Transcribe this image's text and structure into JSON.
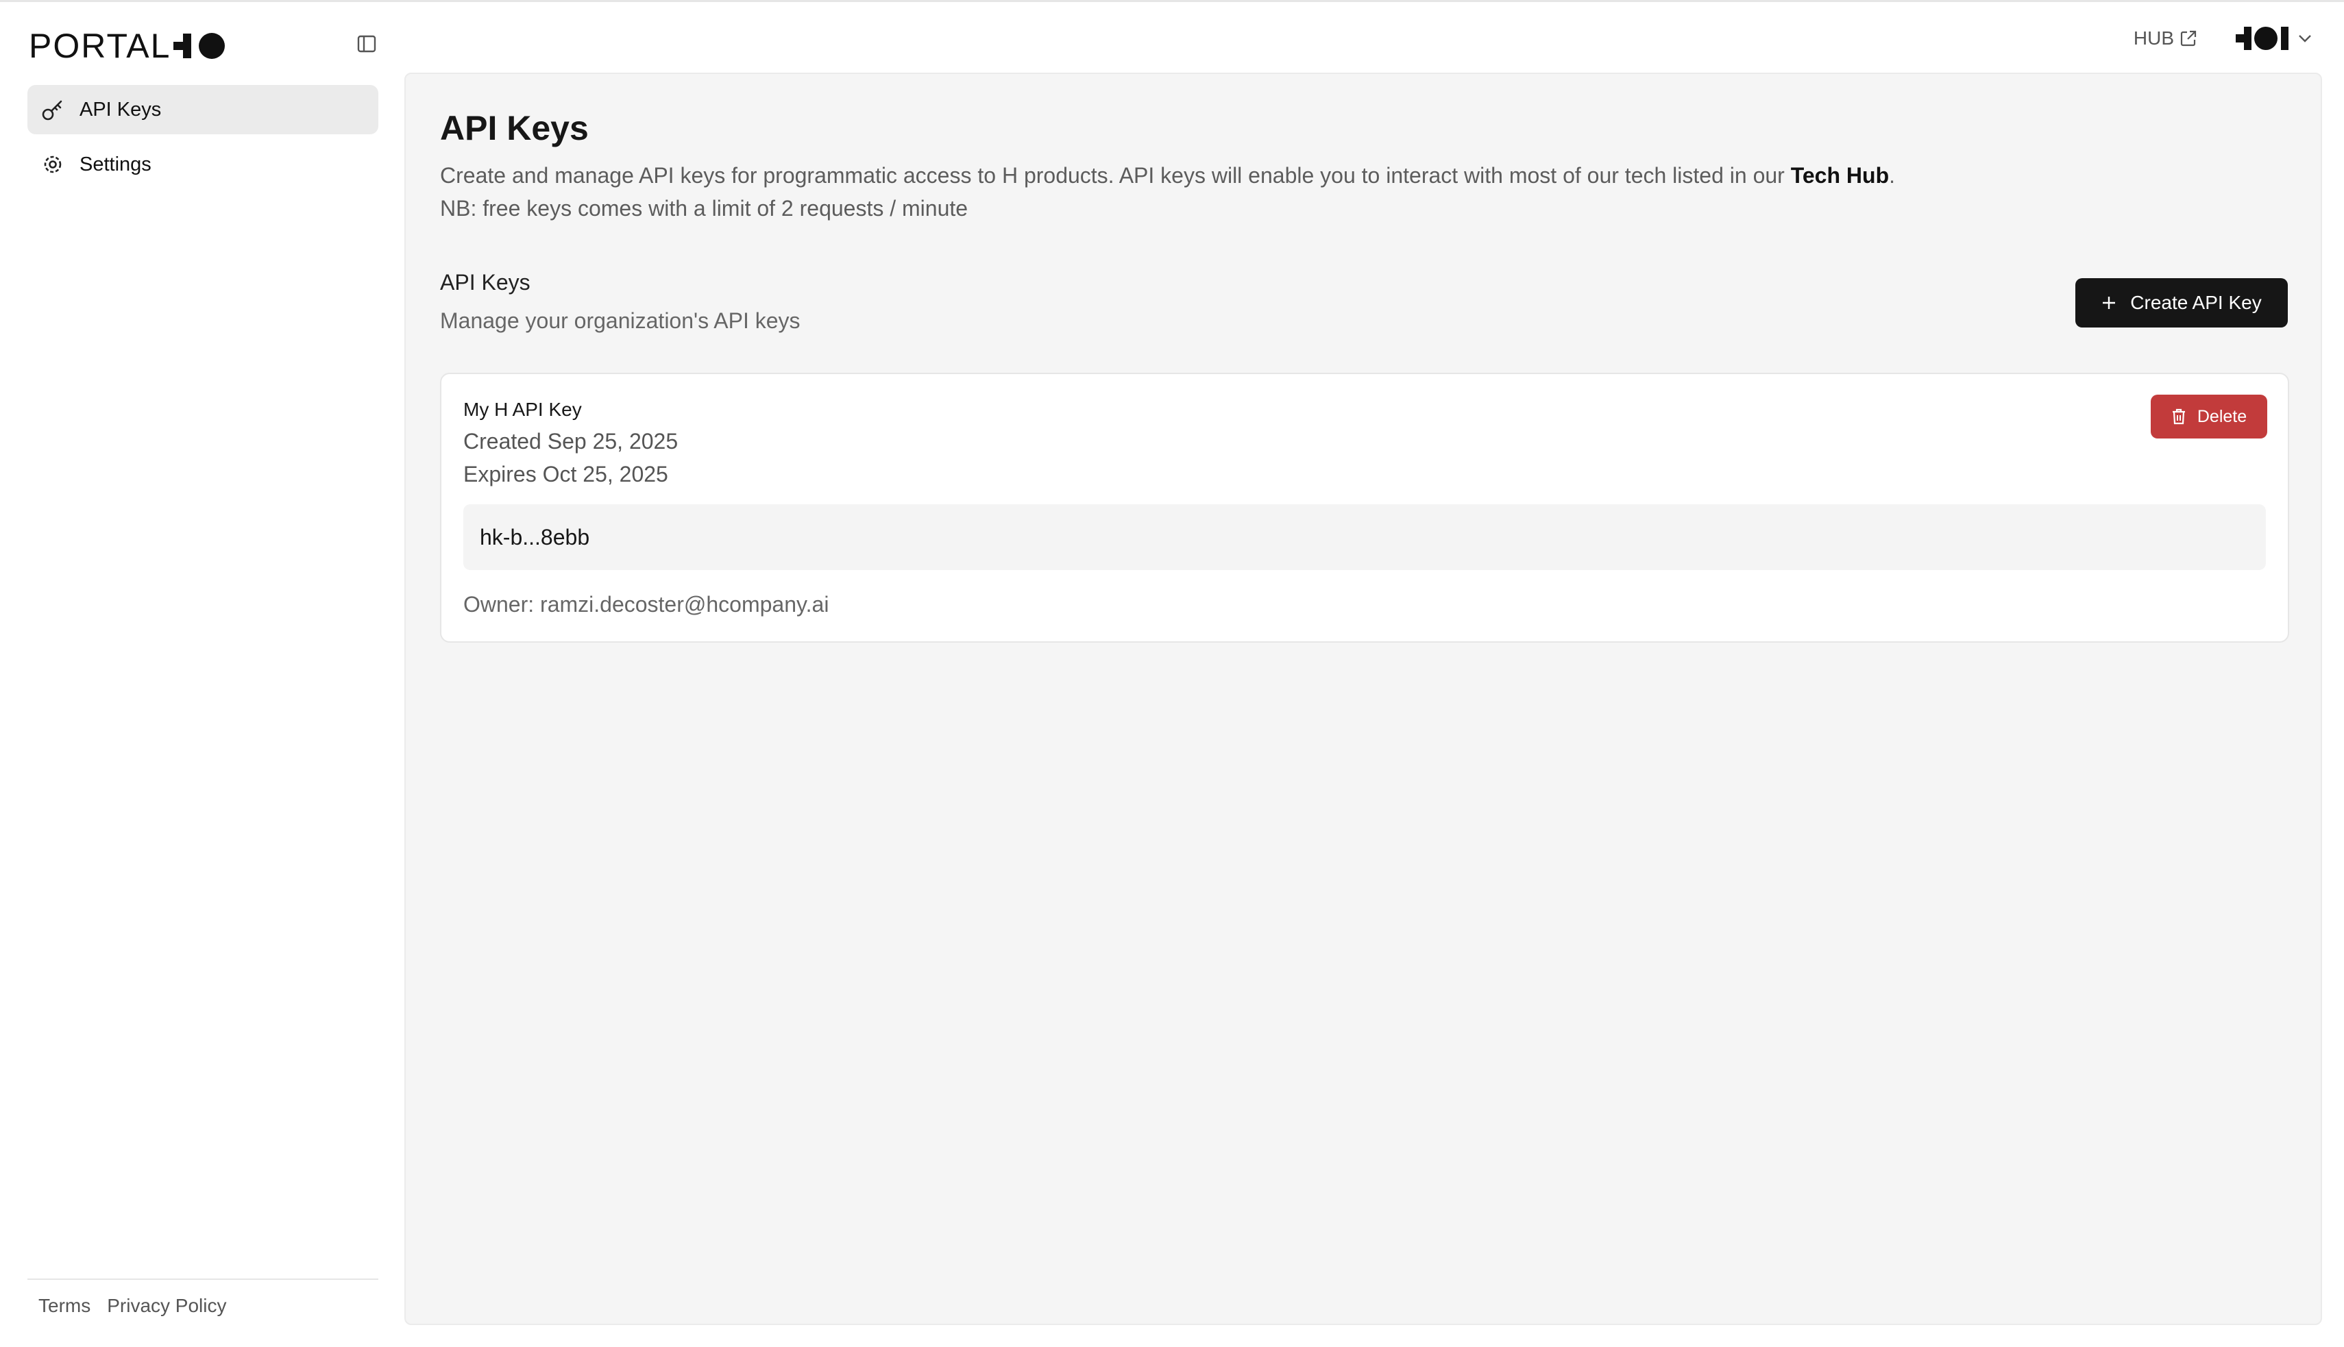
{
  "brand": {
    "name": "PORTAL"
  },
  "sidebar": {
    "items": [
      {
        "label": "API Keys",
        "icon": "key-icon",
        "active": true
      },
      {
        "label": "Settings",
        "icon": "gear-icon",
        "active": false
      }
    ],
    "footer": {
      "terms": "Terms",
      "privacy": "Privacy Policy"
    }
  },
  "header": {
    "hub_label": "HUB"
  },
  "page": {
    "title": "API Keys",
    "description_prefix": "Create and manage API keys for programmatic access to H products. API keys will enable you to interact with most of our tech listed in our ",
    "description_link": "Tech Hub",
    "description_suffix": ".",
    "note": "NB: free keys comes with a limit of 2 requests / minute"
  },
  "section": {
    "title": "API Keys",
    "subtitle": "Manage your organization's API keys",
    "create_label": "Create API Key"
  },
  "keys": [
    {
      "name": "My H API Key",
      "created": "Created Sep 25, 2025",
      "expires": "Expires Oct 25, 2025",
      "value": "hk-b...8ebb",
      "owner": "Owner: ramzi.decoster@hcompany.ai",
      "delete_label": "Delete"
    }
  ],
  "colors": {
    "accent_dark": "#161616",
    "danger": "#c23b3b",
    "panel_bg": "#f5f5f5"
  }
}
